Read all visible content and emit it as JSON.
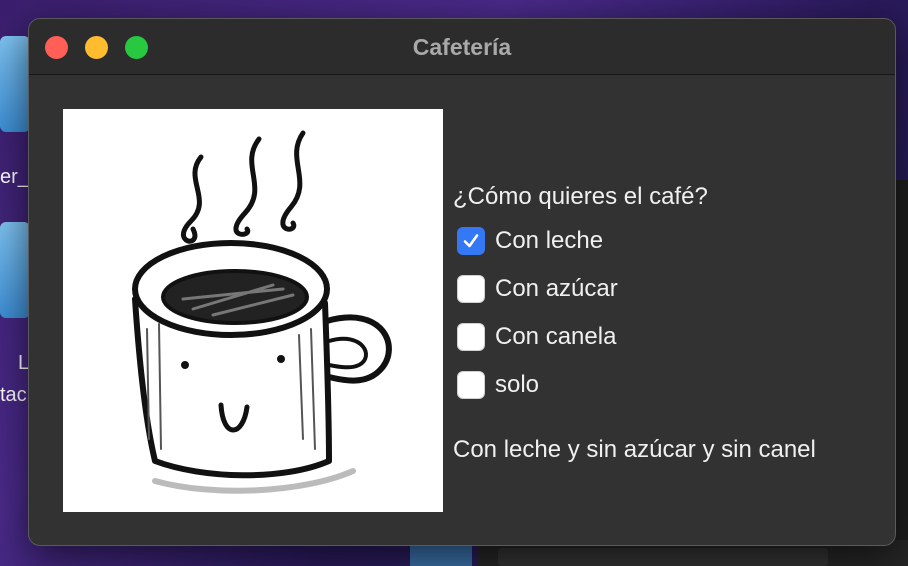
{
  "desktop": {
    "fragment_1": "er_",
    "fragment_2": "L",
    "fragment_3": "tac"
  },
  "window": {
    "title": "Cafetería"
  },
  "image": {
    "icon": "coffee-mug-sketch"
  },
  "form": {
    "question": "¿Cómo quieres el café?",
    "options": [
      {
        "label": "Con leche",
        "checked": true
      },
      {
        "label": "Con azúcar",
        "checked": false
      },
      {
        "label": "Con canela",
        "checked": false
      },
      {
        "label": "solo",
        "checked": false
      }
    ],
    "result": "Con leche y sin azúcar y sin canel"
  },
  "colors": {
    "check_accent": "#3478f6",
    "window_bg": "#323232",
    "close": "#ff5f57",
    "minimize": "#febc2e",
    "maximize": "#28c840"
  }
}
